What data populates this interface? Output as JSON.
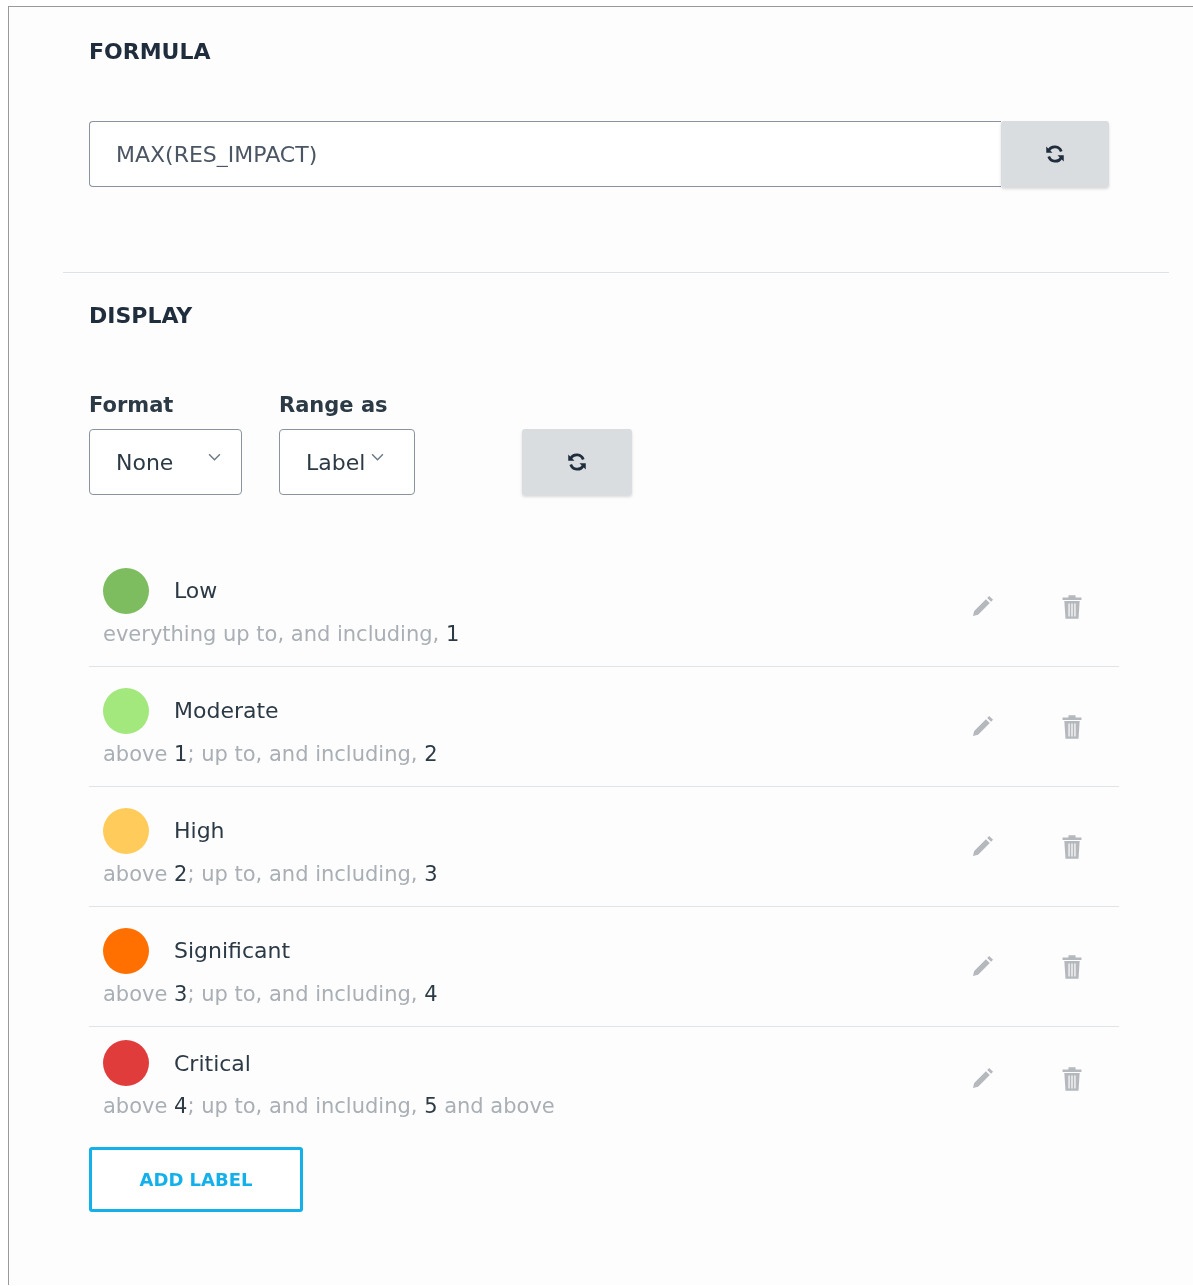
{
  "formula": {
    "heading": "FORMULA",
    "value": "MAX(RES_IMPACT)"
  },
  "display": {
    "heading": "DISPLAY",
    "selects": [
      {
        "label": "Format",
        "value": "None"
      },
      {
        "label": "Range as",
        "value": "Label"
      }
    ],
    "labels": [
      {
        "name": "Low",
        "color": "#7dbd60",
        "range": [
          {
            "text": "everything up to, and including, ",
            "emphasis": false
          },
          {
            "text": "1",
            "emphasis": true
          }
        ]
      },
      {
        "name": "Moderate",
        "color": "#a3e87d",
        "range": [
          {
            "text": "above ",
            "emphasis": false
          },
          {
            "text": "1",
            "emphasis": true
          },
          {
            "text": "; up to, and including, ",
            "emphasis": false
          },
          {
            "text": "2",
            "emphasis": true
          }
        ]
      },
      {
        "name": "High",
        "color": "#ffcc5c",
        "range": [
          {
            "text": "above ",
            "emphasis": false
          },
          {
            "text": "2",
            "emphasis": true
          },
          {
            "text": "; up to, and including, ",
            "emphasis": false
          },
          {
            "text": "3",
            "emphasis": true
          }
        ]
      },
      {
        "name": "Significant",
        "color": "#ff7000",
        "range": [
          {
            "text": "above ",
            "emphasis": false
          },
          {
            "text": "3",
            "emphasis": true
          },
          {
            "text": "; up to, and including, ",
            "emphasis": false
          },
          {
            "text": "4",
            "emphasis": true
          }
        ]
      },
      {
        "name": "Critical",
        "color": "#e03c3c",
        "range": [
          {
            "text": "above ",
            "emphasis": false
          },
          {
            "text": "4",
            "emphasis": true
          },
          {
            "text": "; up to, and including, ",
            "emphasis": false
          },
          {
            "text": "5",
            "emphasis": true
          },
          {
            "text": " and above",
            "emphasis": false
          }
        ]
      }
    ],
    "add_button": "ADD LABEL"
  }
}
